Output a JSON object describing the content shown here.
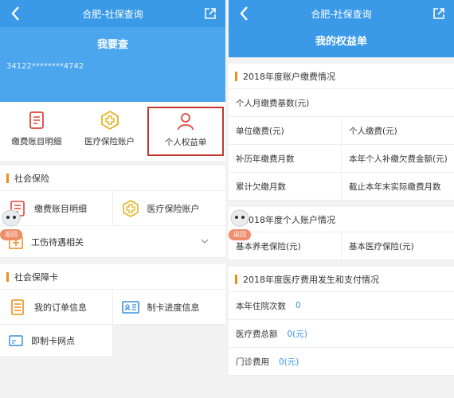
{
  "left": {
    "window_title": "合肥-社保查询",
    "hero_title": "我要查",
    "id_masked": "34122********4742",
    "quick": [
      {
        "label": "缴费账目明细",
        "icon": "ledger-icon"
      },
      {
        "label": "医疗保险账户",
        "icon": "medical-cross-icon"
      },
      {
        "label": "个人权益单",
        "icon": "person-icon"
      }
    ],
    "sections": [
      {
        "title": "社会保险",
        "items": [
          "缴费账目明细",
          "医疗保险账户"
        ],
        "full": "工伤待遇相关"
      },
      {
        "title": "社会保障卡",
        "items": [
          "我的订单信息",
          "制卡进度信息"
        ],
        "full": "即制卡网点"
      }
    ],
    "float_back": "返回"
  },
  "right": {
    "window_title": "合肥-社保查询",
    "page_title": "我的权益单",
    "sec1_title": "2018年度账户缴费情况",
    "sec1_rows": [
      [
        "个人月缴费基数(元)"
      ],
      [
        "单位缴费(元)",
        "个人缴费(元)"
      ],
      [
        "补历年缴费月数",
        "本年个人补缴欠费金额(元)"
      ],
      [
        "累计欠缴月数",
        "截止本年末实际缴费月数"
      ]
    ],
    "sec2_title": "2018年度个人账户情况",
    "sec2_rows": [
      [
        "基本养老保险(元)",
        "基本医疗保险(元)"
      ]
    ],
    "sec3_title": "2018年度医疗费用发生和支付情况",
    "sec3_rows": [
      {
        "label": "本年住院次数",
        "value": "0"
      },
      {
        "label": "医疗费总额",
        "value": "0(元)"
      },
      {
        "label": "门诊费用",
        "value": "0(元)"
      }
    ],
    "float_back": "返回"
  },
  "colors": {
    "brand_blue": "#3a9ae8",
    "accent_orange": "#f08c1a",
    "highlight_red": "#c0392b"
  }
}
